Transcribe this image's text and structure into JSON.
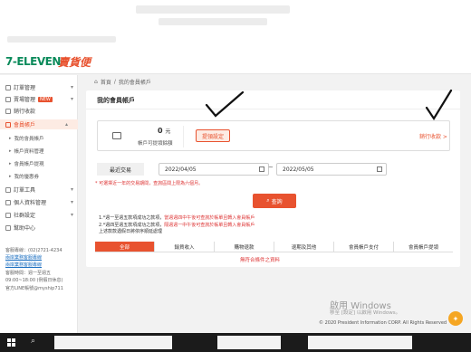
{
  "brand": {
    "logo_main": "7-ELEVEN",
    "logo_sub": "賣貨便"
  },
  "breadcrumb": {
    "home": "首頁",
    "sep": "/",
    "current": "我的會員帳戶"
  },
  "sidebar": {
    "items": [
      {
        "label": "訂單管理"
      },
      {
        "label": "賣場管理",
        "badge": "NEW"
      },
      {
        "label": "銷行收款"
      },
      {
        "label": "會員帳戶"
      }
    ],
    "sub_items": [
      {
        "label": "我的會員帳戶"
      },
      {
        "label": "帳戶資料管理"
      },
      {
        "label": "會員帳戶提現"
      },
      {
        "label": "我的優惠券"
      }
    ],
    "more_items": [
      {
        "label": "訂單工具"
      },
      {
        "label": "個人資料管理"
      },
      {
        "label": "社群設定"
      },
      {
        "label": "幫助中心"
      }
    ],
    "contact": {
      "phone": "客服專線：(02)2721-4234",
      "link1": "兩岸業務客服專線",
      "link2": "兩岸業務客服專線",
      "hours_title": "客服時間：週一至週五",
      "hours": "09:00~18:00 (例假日休息)",
      "line": "官方LINE帳號@myship711"
    }
  },
  "card": {
    "title": "我的會員帳戶",
    "amount": "0",
    "amount_unit": "元",
    "amount_label": "帳戶可提領餘額",
    "withdraw_button": "提領設定",
    "record_link": "銷行收款 >",
    "date_label": "最近交易",
    "date_from": "2022/04/05",
    "date_to": "2022/05/05",
    "date_sep": "~",
    "note": "* 可選擇近一年的交易期間，查詢區間上限為六個月。",
    "query_button": "查詢",
    "notes": [
      {
        "prefix": "1.*週一至週五款項成功之款項，",
        "red": "當週週四中午後可查詢於帳單且轉入會員帳戶"
      },
      {
        "prefix": "2.*週四至週五款項成功之款項，",
        "red": "隔週週一中午後可查詢於帳單且轉入會員帳戶"
      },
      {
        "prefix": "   上述款款遇假日將依序順延處理",
        "red": ""
      }
    ],
    "tabs": [
      "全部",
      "銷貨收入",
      "購物退款",
      "退期及其他",
      "會員帳戶支付",
      "會員帳戶提領"
    ],
    "no_data": "無符合條件之資料"
  },
  "watermark": {
    "title": "啟用 Windows",
    "sub": "移至 [設定] 以啟用 Windows。"
  },
  "copyright": "© 2020 President Information CORP. All Rights Reserved"
}
